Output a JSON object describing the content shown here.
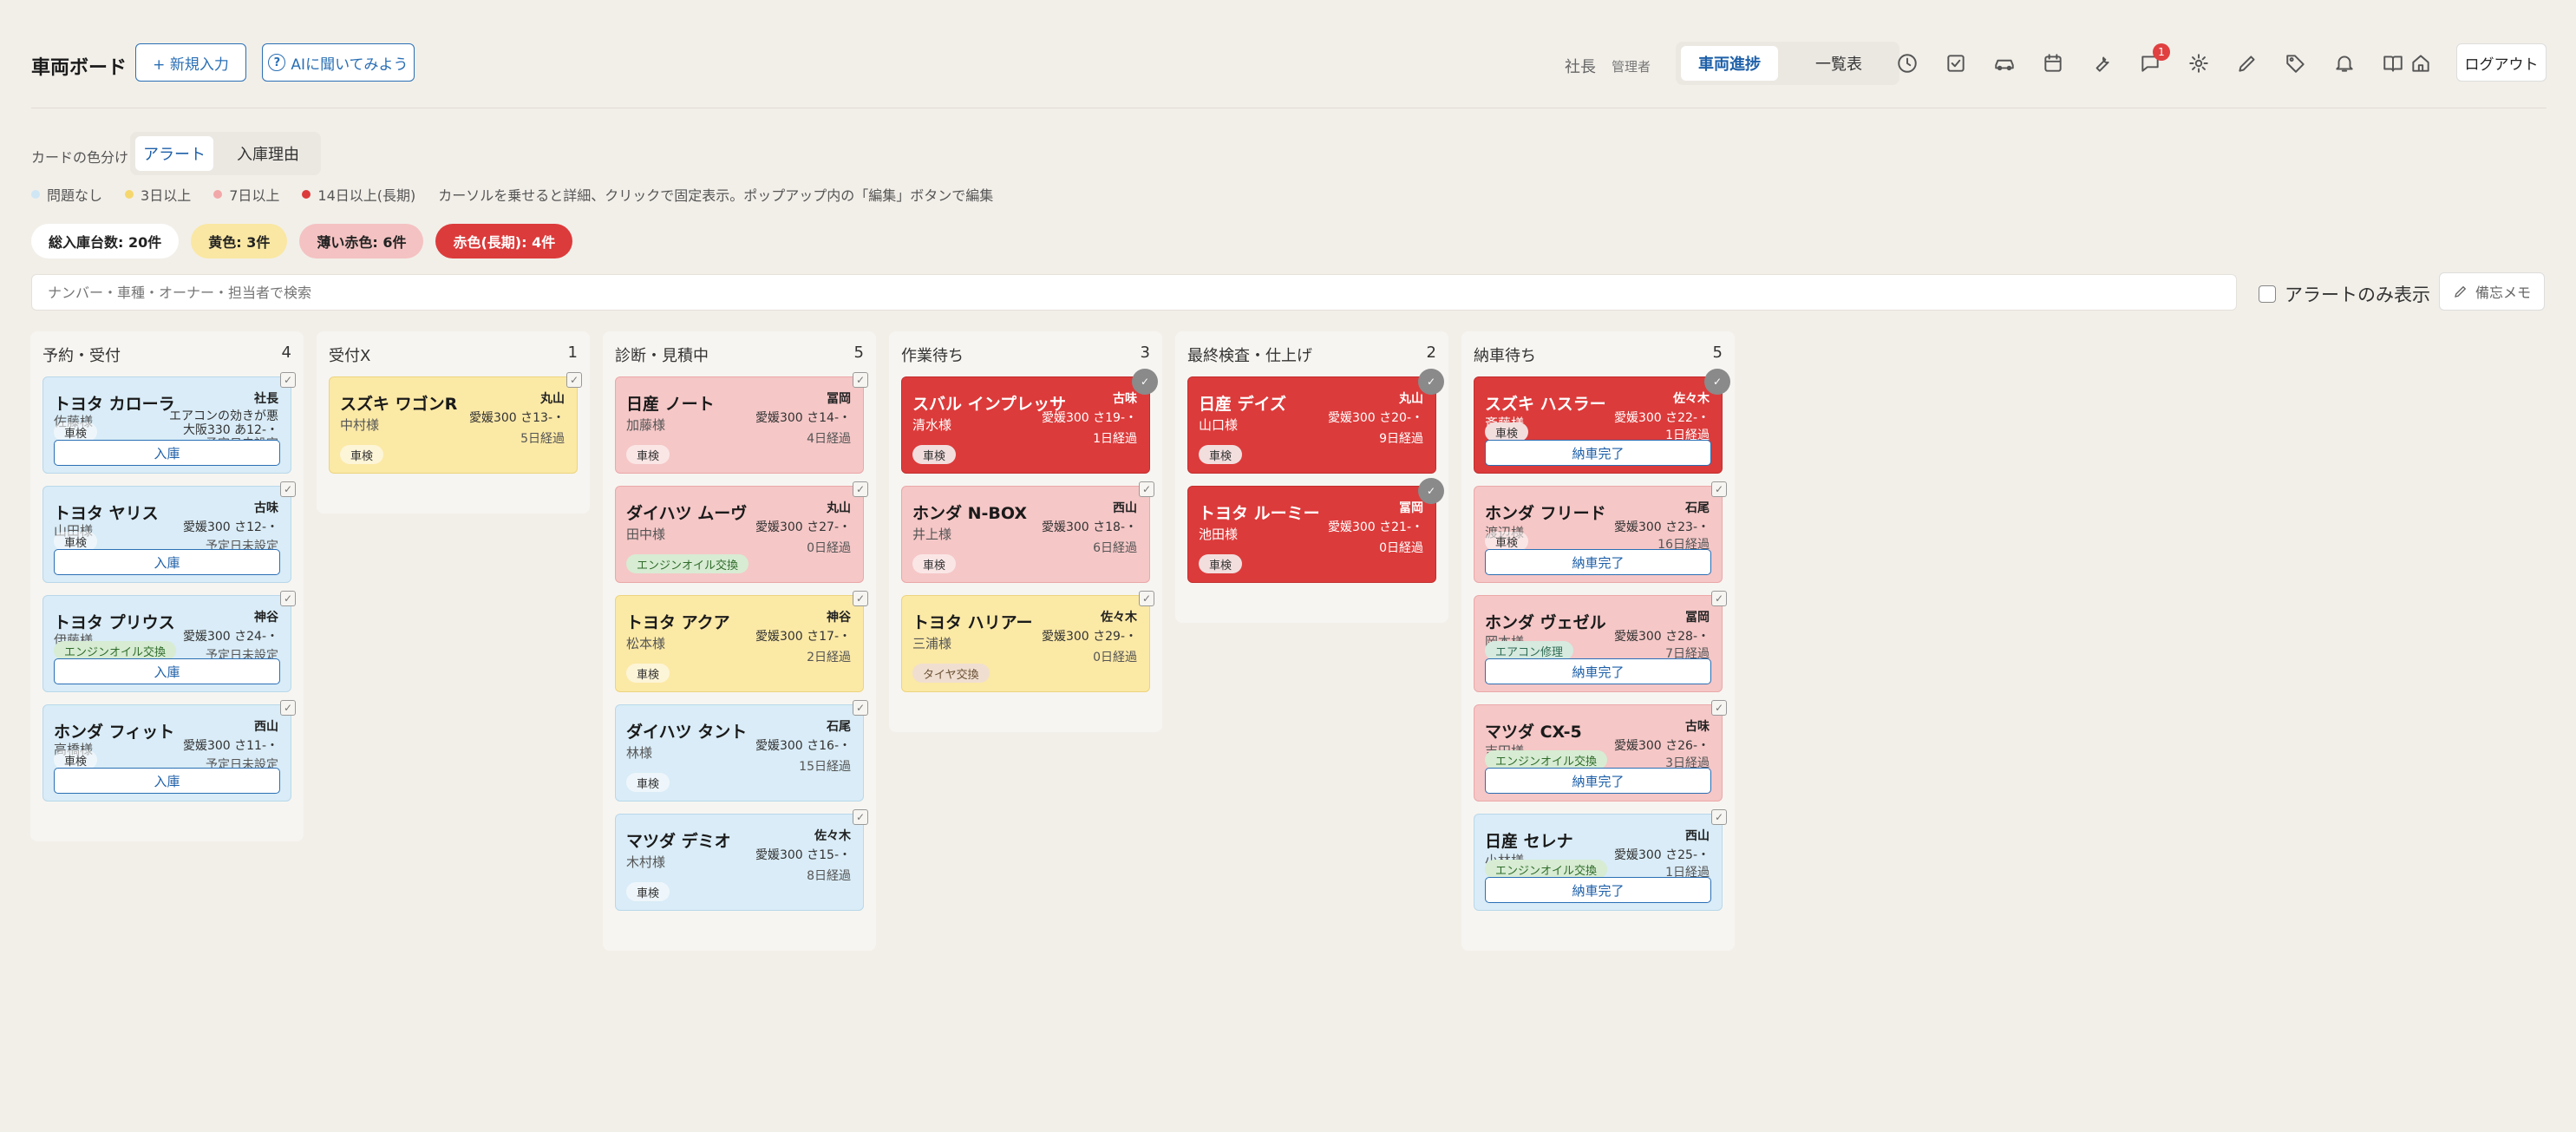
{
  "header": {
    "app_title": "車両ボード",
    "new_entry": "+ 新規入力",
    "ask_ai": "AIに聞いてみよう",
    "ask_ai_icon": "?",
    "user_name": "社長",
    "user_role": "管理者",
    "view_progress": "車両進捗",
    "view_list": "一覧表",
    "notif_count": "1",
    "logout": "ログアウト",
    "icons": [
      "clock-icon",
      "checklist-icon",
      "car-icon",
      "calendar-icon",
      "wrench-icon",
      "chat-icon",
      "gear-icon",
      "pen-icon",
      "tag-icon",
      "bell-icon",
      "book-icon",
      "home-icon"
    ]
  },
  "colormode": {
    "label": "カードの色分け",
    "alert_tab": "アラート",
    "reason_tab": "入庫理由"
  },
  "legend": {
    "items": [
      {
        "label": "問題なし",
        "color": "#cfe6f5"
      },
      {
        "label": "3日以上",
        "color": "#f5d76e"
      },
      {
        "label": "7日以上",
        "color": "#f2a8a8"
      },
      {
        "label": "14日以上(長期)",
        "color": "#dc3b3b"
      }
    ],
    "hint": "カーソルを乗せると詳細、クリックで固定表示。ポップアップ内の「編集」ボタンで編集"
  },
  "chips": {
    "total": "総入庫台数: 20件",
    "yellow": "黄色: 3件",
    "pink": "薄い赤色: 6件",
    "red": "赤色(長期): 4件"
  },
  "search": {
    "placeholder": "ナンバー・車種・オーナー・担当者で検索"
  },
  "alert_only": "アラートのみ表示",
  "memo": "備忘メモ",
  "columns": [
    {
      "title": "予約・受付",
      "count": "4",
      "cards": [
        {
          "car": "トヨタ カローラ",
          "owner": "佐藤様",
          "staff": "社長",
          "note": "エアコンの効きが悪",
          "note2": "大阪330 あ12-・",
          "due": "予定日未設定",
          "tag": "車検",
          "action": "入庫"
        },
        {
          "car": "トヨタ ヤリス",
          "owner": "山田様",
          "staff": "古味",
          "plate": "愛媛300 さ12-・",
          "due": "予定日未設定",
          "tag": "車検",
          "action": "入庫"
        },
        {
          "car": "トヨタ プリウス",
          "owner": "伊藤様",
          "staff": "神谷",
          "plate": "愛媛300 さ24-・",
          "due": "予定日未設定",
          "tag": "エンジンオイル交換",
          "action": "入庫"
        },
        {
          "car": "ホンダ フィット",
          "owner": "高橋様",
          "staff": "西山",
          "plate": "愛媛300 さ11-・",
          "due": "予定日未設定",
          "tag": "車検",
          "action": "入庫"
        }
      ]
    },
    {
      "title": "受付X",
      "count": "1",
      "cards": [
        {
          "car": "スズキ ワゴンR",
          "owner": "中村様",
          "staff": "丸山",
          "plate": "愛媛300 さ13-・",
          "days": "5日経過",
          "tag": "車検"
        }
      ]
    },
    {
      "title": "診断・見積中",
      "count": "5",
      "cards": [
        {
          "car": "日産 ノート",
          "owner": "加藤様",
          "staff": "冨岡",
          "plate": "愛媛300 さ14-・",
          "days": "4日経過",
          "tag": "車検"
        },
        {
          "car": "ダイハツ ムーヴ",
          "owner": "田中様",
          "staff": "丸山",
          "plate": "愛媛300 さ27-・",
          "days": "0日経過",
          "tag": "エンジンオイル交換"
        },
        {
          "car": "トヨタ アクア",
          "owner": "松本様",
          "staff": "神谷",
          "plate": "愛媛300 さ17-・",
          "days": "2日経過",
          "tag": "車検"
        },
        {
          "car": "ダイハツ タント",
          "owner": "林様",
          "staff": "石尾",
          "plate": "愛媛300 さ16-・",
          "days": "15日経過",
          "tag": "車検"
        },
        {
          "car": "マツダ デミオ",
          "owner": "木村様",
          "staff": "佐々木",
          "plate": "愛媛300 さ15-・",
          "days": "8日経過",
          "tag": "車検"
        }
      ]
    },
    {
      "title": "作業待ち",
      "count": "3",
      "cards": [
        {
          "car": "スバル インプレッサ",
          "owner": "清水様",
          "staff": "古味",
          "plate": "愛媛300 さ19-・",
          "days": "1日経過",
          "tag": "車検"
        },
        {
          "car": "ホンダ N-BOX",
          "owner": "井上様",
          "staff": "西山",
          "plate": "愛媛300 さ18-・",
          "days": "6日経過",
          "tag": "車検"
        },
        {
          "car": "トヨタ ハリアー",
          "owner": "三浦様",
          "staff": "佐々木",
          "plate": "愛媛300 さ29-・",
          "days": "0日経過",
          "tag": "タイヤ交換"
        }
      ]
    },
    {
      "title": "最終検査・仕上げ",
      "count": "2",
      "cards": [
        {
          "car": "日産 デイズ",
          "owner": "山口様",
          "staff": "丸山",
          "plate": "愛媛300 さ20-・",
          "days": "9日経過",
          "tag": "車検"
        },
        {
          "car": "トヨタ ルーミー",
          "owner": "池田様",
          "staff": "冨岡",
          "plate": "愛媛300 さ21-・",
          "days": "0日経過",
          "tag": "車検"
        }
      ]
    },
    {
      "title": "納車待ち",
      "count": "5",
      "cards": [
        {
          "car": "スズキ ハスラー",
          "owner": "斎藤様",
          "staff": "佐々木",
          "plate": "愛媛300 さ22-・",
          "days": "1日経過",
          "tag": "車検",
          "action": "納車完了"
        },
        {
          "car": "ホンダ フリード",
          "owner": "渡辺様",
          "staff": "石尾",
          "plate": "愛媛300 さ23-・",
          "days": "16日経過",
          "tag": "車検",
          "action": "納車完了"
        },
        {
          "car": "ホンダ ヴェゼル",
          "owner": "岡本様",
          "staff": "冨岡",
          "plate": "愛媛300 さ28-・",
          "days": "7日経過",
          "tag": "エアコン修理",
          "action": "納車完了"
        },
        {
          "car": "マツダ CX-5",
          "owner": "吉田様",
          "staff": "古味",
          "plate": "愛媛300 さ26-・",
          "days": "3日経過",
          "tag": "エンジンオイル交換",
          "action": "納車完了"
        },
        {
          "car": "日産 セレナ",
          "owner": "小林様",
          "staff": "西山",
          "plate": "愛媛300 さ25-・",
          "days": "1日経過",
          "tag": "エンジンオイル交換",
          "action": "納車完了"
        }
      ]
    }
  ]
}
